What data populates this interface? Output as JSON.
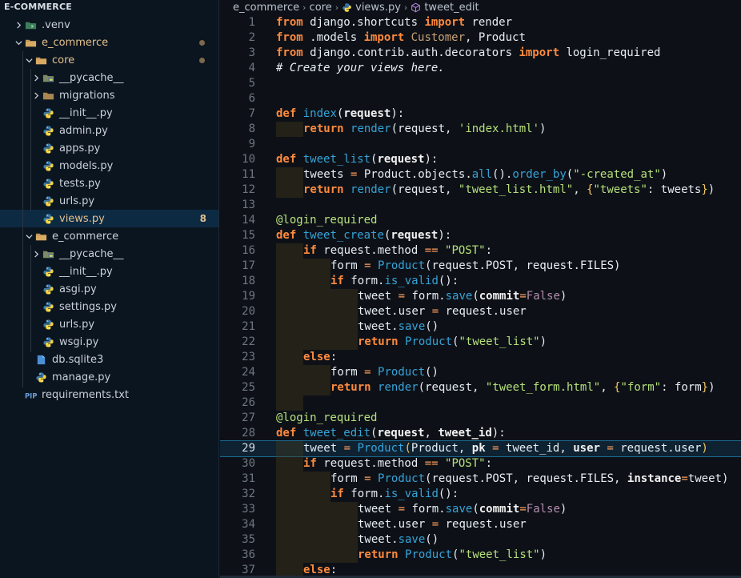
{
  "explorer": {
    "title": "E-COMMERCE",
    "items": [
      {
        "label": ".venv",
        "depth": 1,
        "type": "folder-venv",
        "open": false
      },
      {
        "label": "e_commerce",
        "depth": 1,
        "type": "folder",
        "open": true,
        "modified": true
      },
      {
        "label": "core",
        "depth": 2,
        "type": "folder",
        "open": true,
        "modified": true
      },
      {
        "label": "__pycache__",
        "depth": 3,
        "type": "folder-pycache",
        "open": false
      },
      {
        "label": "migrations",
        "depth": 3,
        "type": "folder-plain",
        "open": false
      },
      {
        "label": "__init__.py",
        "depth": 3,
        "type": "python"
      },
      {
        "label": "admin.py",
        "depth": 3,
        "type": "python"
      },
      {
        "label": "apps.py",
        "depth": 3,
        "type": "python"
      },
      {
        "label": "models.py",
        "depth": 3,
        "type": "python"
      },
      {
        "label": "tests.py",
        "depth": 3,
        "type": "python"
      },
      {
        "label": "urls.py",
        "depth": 3,
        "type": "python"
      },
      {
        "label": "views.py",
        "depth": 3,
        "type": "python",
        "selected": true,
        "badge": "8"
      },
      {
        "label": "e_commerce",
        "depth": 2,
        "type": "folder",
        "open": true
      },
      {
        "label": "__pycache__",
        "depth": 3,
        "type": "folder-pycache",
        "open": false
      },
      {
        "label": "__init__.py",
        "depth": 3,
        "type": "python"
      },
      {
        "label": "asgi.py",
        "depth": 3,
        "type": "python"
      },
      {
        "label": "settings.py",
        "depth": 3,
        "type": "python"
      },
      {
        "label": "urls.py",
        "depth": 3,
        "type": "python"
      },
      {
        "label": "wsgi.py",
        "depth": 3,
        "type": "python"
      },
      {
        "label": "db.sqlite3",
        "depth": 2,
        "type": "database"
      },
      {
        "label": "manage.py",
        "depth": 2,
        "type": "python"
      },
      {
        "label": "requirements.txt",
        "depth": 1,
        "type": "pip"
      }
    ]
  },
  "breadcrumb": {
    "parts": [
      "e_commerce",
      "core",
      "views.py",
      "tweet_edit"
    ]
  },
  "editor": {
    "current_line": 29,
    "lines": [
      {
        "n": "1",
        "ind": 0,
        "t": [
          [
            "kw-plain",
            "from"
          ],
          [
            "p",
            " django.shortcuts "
          ],
          [
            "kw-plain",
            "import"
          ],
          [
            "p",
            " render"
          ]
        ]
      },
      {
        "n": "2",
        "ind": 0,
        "t": [
          [
            "kw-plain",
            "from"
          ],
          [
            "p",
            " .models "
          ],
          [
            "kw-plain",
            "import"
          ],
          [
            "p",
            " "
          ],
          [
            "cls",
            "Customer"
          ],
          [
            "p",
            ", Product"
          ]
        ]
      },
      {
        "n": "3",
        "ind": 0,
        "t": [
          [
            "kw-plain",
            "from"
          ],
          [
            "p",
            " django.contrib.auth.decorators "
          ],
          [
            "kw-plain",
            "import"
          ],
          [
            "p",
            " login_required"
          ]
        ]
      },
      {
        "n": "4",
        "ind": 0,
        "t": [
          [
            "cm",
            "# Create your views here."
          ]
        ]
      },
      {
        "n": "5",
        "ind": 0,
        "t": []
      },
      {
        "n": "6",
        "ind": 0,
        "t": []
      },
      {
        "n": "7",
        "ind": 0,
        "t": [
          [
            "kw",
            "def"
          ],
          [
            "p",
            " "
          ],
          [
            "fn",
            "index"
          ],
          [
            "p",
            "("
          ],
          [
            "param",
            "request"
          ],
          [
            "p",
            "):"
          ]
        ]
      },
      {
        "n": "8",
        "ind": 1,
        "t": [
          [
            "kw",
            "return"
          ],
          [
            "p",
            " "
          ],
          [
            "fn",
            "render"
          ],
          [
            "p",
            "(request, "
          ],
          [
            "str",
            "'index.html'"
          ],
          [
            "p",
            ")"
          ]
        ]
      },
      {
        "n": "9",
        "ind": 0,
        "t": []
      },
      {
        "n": "10",
        "ind": 0,
        "t": [
          [
            "kw",
            "def"
          ],
          [
            "p",
            " "
          ],
          [
            "fn",
            "tweet_list"
          ],
          [
            "p",
            "("
          ],
          [
            "param",
            "request"
          ],
          [
            "p",
            "):"
          ]
        ]
      },
      {
        "n": "11",
        "ind": 1,
        "t": [
          [
            "p",
            "tweets "
          ],
          [
            "op",
            "="
          ],
          [
            "p",
            " Product.objects."
          ],
          [
            "fn",
            "all"
          ],
          [
            "p",
            "()."
          ],
          [
            "fn",
            "order_by"
          ],
          [
            "p",
            "("
          ],
          [
            "str",
            "\"-created_at\""
          ],
          [
            "p",
            ")"
          ]
        ]
      },
      {
        "n": "12",
        "ind": 1,
        "t": [
          [
            "kw",
            "return"
          ],
          [
            "p",
            " "
          ],
          [
            "fn",
            "render"
          ],
          [
            "p",
            "(request, "
          ],
          [
            "str",
            "\"tweet_list.html\""
          ],
          [
            "p",
            ", "
          ],
          [
            "brace",
            "{"
          ],
          [
            "str",
            "\"tweets\""
          ],
          [
            "p",
            ": tweets"
          ],
          [
            "brace",
            "}"
          ],
          [
            "p",
            ")"
          ]
        ]
      },
      {
        "n": "13",
        "ind": 0,
        "t": []
      },
      {
        "n": "14",
        "ind": 0,
        "t": [
          [
            "dec",
            "@login_required"
          ]
        ]
      },
      {
        "n": "15",
        "ind": 0,
        "t": [
          [
            "kw",
            "def"
          ],
          [
            "p",
            " "
          ],
          [
            "fn",
            "tweet_create"
          ],
          [
            "p",
            "("
          ],
          [
            "param",
            "request"
          ],
          [
            "p",
            "):"
          ]
        ]
      },
      {
        "n": "16",
        "ind": 1,
        "t": [
          [
            "kw",
            "if"
          ],
          [
            "p",
            " request.method "
          ],
          [
            "op",
            "=="
          ],
          [
            "p",
            " "
          ],
          [
            "str",
            "\"POST\""
          ],
          [
            "p",
            ":"
          ]
        ]
      },
      {
        "n": "17",
        "ind": 2,
        "t": [
          [
            "p",
            "form "
          ],
          [
            "op",
            "="
          ],
          [
            "p",
            " "
          ],
          [
            "fn",
            "Product"
          ],
          [
            "p",
            "(request.POST, request.FILES)"
          ]
        ]
      },
      {
        "n": "18",
        "ind": 2,
        "t": [
          [
            "kw",
            "if"
          ],
          [
            "p",
            " form."
          ],
          [
            "fn",
            "is_valid"
          ],
          [
            "p",
            "():"
          ]
        ]
      },
      {
        "n": "19",
        "ind": 3,
        "t": [
          [
            "p",
            "tweet "
          ],
          [
            "op",
            "="
          ],
          [
            "p",
            " form."
          ],
          [
            "fn",
            "save"
          ],
          [
            "p",
            "("
          ],
          [
            "param",
            "commit"
          ],
          [
            "op",
            "="
          ],
          [
            "bool",
            "False"
          ],
          [
            "p",
            ")"
          ]
        ]
      },
      {
        "n": "20",
        "ind": 3,
        "t": [
          [
            "p",
            "tweet.user "
          ],
          [
            "op",
            "="
          ],
          [
            "p",
            " request.user"
          ]
        ]
      },
      {
        "n": "21",
        "ind": 3,
        "t": [
          [
            "p",
            "tweet."
          ],
          [
            "fn",
            "save"
          ],
          [
            "p",
            "()"
          ]
        ]
      },
      {
        "n": "22",
        "ind": 3,
        "t": [
          [
            "kw",
            "return"
          ],
          [
            "p",
            " "
          ],
          [
            "fn",
            "Product"
          ],
          [
            "p",
            "("
          ],
          [
            "str",
            "\"tweet_list\""
          ],
          [
            "p",
            ")"
          ]
        ]
      },
      {
        "n": "23",
        "ind": 1,
        "t": [
          [
            "kw",
            "else"
          ],
          [
            "p",
            ":"
          ]
        ]
      },
      {
        "n": "24",
        "ind": 2,
        "t": [
          [
            "p",
            "form "
          ],
          [
            "op",
            "="
          ],
          [
            "p",
            " "
          ],
          [
            "fn",
            "Product"
          ],
          [
            "p",
            "()"
          ]
        ]
      },
      {
        "n": "25",
        "ind": 2,
        "t": [
          [
            "kw",
            "return"
          ],
          [
            "p",
            " "
          ],
          [
            "fn",
            "render"
          ],
          [
            "p",
            "(request, "
          ],
          [
            "str",
            "\"tweet_form.html\""
          ],
          [
            "p",
            ", "
          ],
          [
            "brace",
            "{"
          ],
          [
            "str",
            "\"form\""
          ],
          [
            "p",
            ": form"
          ],
          [
            "brace",
            "}"
          ],
          [
            "p",
            ")"
          ]
        ]
      },
      {
        "n": "26",
        "ind": 1,
        "t": []
      },
      {
        "n": "27",
        "ind": 0,
        "t": [
          [
            "dec",
            "@login_required"
          ]
        ]
      },
      {
        "n": "28",
        "ind": 0,
        "t": [
          [
            "kw",
            "def"
          ],
          [
            "p",
            " "
          ],
          [
            "fn",
            "tweet_edit"
          ],
          [
            "p",
            "("
          ],
          [
            "param",
            "request"
          ],
          [
            "p",
            ", "
          ],
          [
            "param",
            "tweet_id"
          ],
          [
            "p",
            "):"
          ]
        ]
      },
      {
        "n": "29",
        "ind": 1,
        "t": [
          [
            "p",
            "tweet "
          ],
          [
            "op",
            "="
          ],
          [
            "p",
            " "
          ],
          [
            "fn",
            "Product"
          ],
          [
            "brace",
            "("
          ],
          [
            "p",
            "Product, "
          ],
          [
            "param",
            "pk"
          ],
          [
            "p",
            " "
          ],
          [
            "op",
            "="
          ],
          [
            "p",
            " tweet_id, "
          ],
          [
            "param",
            "user"
          ],
          [
            "p",
            " "
          ],
          [
            "op",
            "="
          ],
          [
            "p",
            " request.user"
          ],
          [
            "brace",
            ")"
          ]
        ]
      },
      {
        "n": "30",
        "ind": 1,
        "t": [
          [
            "kw",
            "if"
          ],
          [
            "p",
            " request.method "
          ],
          [
            "op",
            "=="
          ],
          [
            "p",
            " "
          ],
          [
            "str",
            "\"POST\""
          ],
          [
            "p",
            ":"
          ]
        ]
      },
      {
        "n": "31",
        "ind": 2,
        "t": [
          [
            "p",
            "form "
          ],
          [
            "op",
            "="
          ],
          [
            "p",
            " "
          ],
          [
            "fn",
            "Product"
          ],
          [
            "p",
            "(request.POST, request.FILES, "
          ],
          [
            "param",
            "instance"
          ],
          [
            "op",
            "="
          ],
          [
            "p",
            "tweet)"
          ]
        ]
      },
      {
        "n": "32",
        "ind": 2,
        "t": [
          [
            "kw",
            "if"
          ],
          [
            "p",
            " form."
          ],
          [
            "fn",
            "is_valid"
          ],
          [
            "p",
            "():"
          ]
        ]
      },
      {
        "n": "33",
        "ind": 3,
        "t": [
          [
            "p",
            "tweet "
          ],
          [
            "op",
            "="
          ],
          [
            "p",
            " form."
          ],
          [
            "fn",
            "save"
          ],
          [
            "p",
            "("
          ],
          [
            "param",
            "commit"
          ],
          [
            "op",
            "="
          ],
          [
            "bool",
            "False"
          ],
          [
            "p",
            ")"
          ]
        ]
      },
      {
        "n": "34",
        "ind": 3,
        "t": [
          [
            "p",
            "tweet.user "
          ],
          [
            "op",
            "="
          ],
          [
            "p",
            " request.user"
          ]
        ]
      },
      {
        "n": "35",
        "ind": 3,
        "t": [
          [
            "p",
            "tweet."
          ],
          [
            "fn",
            "save"
          ],
          [
            "p",
            "()"
          ]
        ]
      },
      {
        "n": "36",
        "ind": 3,
        "t": [
          [
            "kw",
            "return"
          ],
          [
            "p",
            " "
          ],
          [
            "fn",
            "Product"
          ],
          [
            "p",
            "("
          ],
          [
            "str",
            "\"tweet_list\""
          ],
          [
            "p",
            ")"
          ]
        ]
      },
      {
        "n": "37",
        "ind": 1,
        "t": [
          [
            "kw",
            "else"
          ],
          [
            "p",
            ":"
          ]
        ]
      }
    ]
  },
  "colors": {
    "background": "#0d1117",
    "sidebar": "#0b1520",
    "selection": "#0d2a43",
    "keyword": "#ff8a3d",
    "function": "#36a3d9",
    "string": "#b5e07a",
    "modified": "#e2c08d"
  },
  "icons": {
    "folder": "folder-icon",
    "python": "python-file-icon",
    "database": "database-icon",
    "pip": "pip-requirements-icon",
    "symbol": "method-symbol-icon"
  }
}
